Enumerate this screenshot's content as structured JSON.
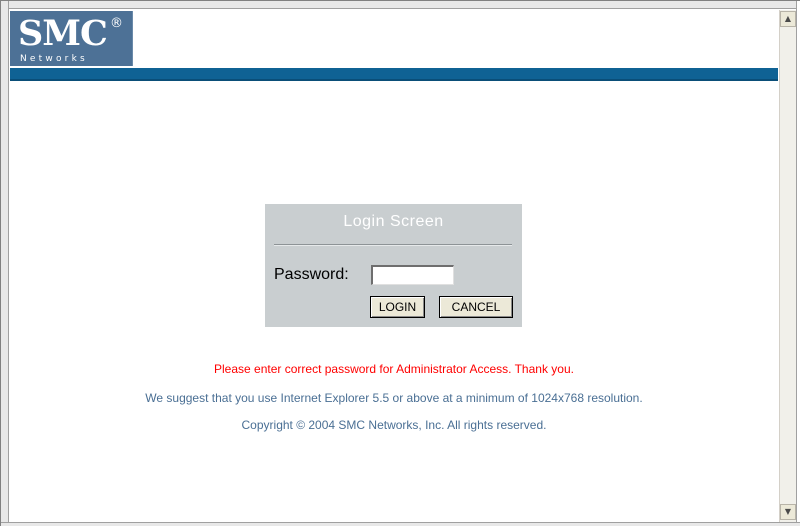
{
  "logo": {
    "main": "SMC",
    "registered": "®",
    "sub": "Networks"
  },
  "login": {
    "title": "Login Screen",
    "password_label": "Password:",
    "password_value": "",
    "login_button": "LOGIN",
    "cancel_button": "CANCEL"
  },
  "messages": {
    "error": "Please enter correct password for Administrator Access. Thank you.",
    "suggestion": "We suggest that you use Internet Explorer 5.5 or above at a minimum of 1024x768 resolution.",
    "copyright": "Copyright © 2004 SMC Networks, Inc. All rights reserved."
  },
  "scrollbar": {
    "up_icon": "▲",
    "down_icon": "▼"
  },
  "colors": {
    "brand_blue": "#0f6294",
    "logo_bg": "#4d7196",
    "panel_bg": "#c9ced0",
    "error_text": "#ff0000",
    "info_text": "#4a6f94"
  }
}
